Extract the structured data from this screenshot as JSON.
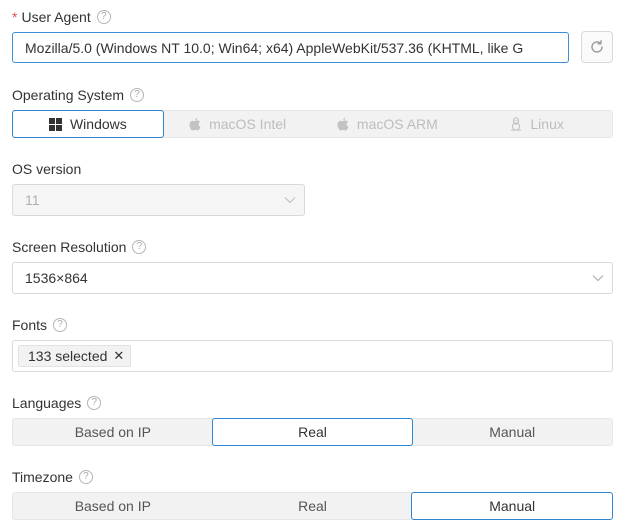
{
  "user_agent": {
    "required_mark": "*",
    "label": "User Agent",
    "value": "Mozilla/5.0 (Windows NT 10.0; Win64; x64) AppleWebKit/537.36 (KHTML, like G"
  },
  "operating_system": {
    "label": "Operating System",
    "options": [
      {
        "label": "Windows",
        "icon": "windows-icon",
        "state": "selected"
      },
      {
        "label": "macOS Intel",
        "icon": "apple-icon",
        "state": "disabled"
      },
      {
        "label": "macOS ARM",
        "icon": "apple-icon",
        "state": "disabled"
      },
      {
        "label": "Linux",
        "icon": "linux-icon",
        "state": "disabled"
      }
    ]
  },
  "os_version": {
    "label": "OS version",
    "value": "11"
  },
  "screen_resolution": {
    "label": "Screen Resolution",
    "value": "1536×864"
  },
  "fonts": {
    "label": "Fonts",
    "tag": "133 selected"
  },
  "languages": {
    "label": "Languages",
    "options": [
      "Based on IP",
      "Real",
      "Manual"
    ],
    "selected": "Real"
  },
  "timezone": {
    "label": "Timezone",
    "options": [
      "Based on IP",
      "Real",
      "Manual"
    ],
    "selected": "Manual"
  },
  "colors": {
    "accent": "#2f86d2",
    "required": "#e34d59"
  }
}
